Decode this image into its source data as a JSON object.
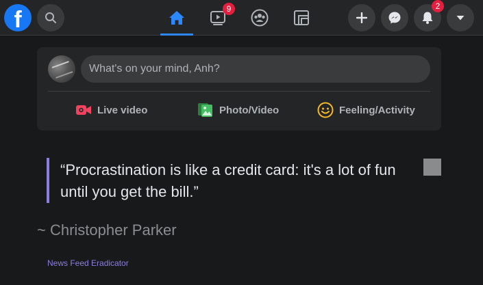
{
  "topbar": {
    "logo_letter": "f",
    "nav": [
      {
        "name": "home",
        "active": true
      },
      {
        "name": "watch",
        "badge": "9"
      },
      {
        "name": "groups"
      },
      {
        "name": "gaming"
      }
    ],
    "notifications_badge": "2"
  },
  "composer": {
    "placeholder": "What's on your mind, Anh?",
    "actions": [
      {
        "label": "Live video",
        "icon": "live-video-icon",
        "color": "#f3425f"
      },
      {
        "label": "Photo/Video",
        "icon": "photo-icon",
        "color": "#45bd62"
      },
      {
        "label": "Feeling/Activity",
        "icon": "feeling-icon",
        "color": "#f7b928"
      }
    ]
  },
  "quote": {
    "text": "“Procrastination is like a credit card: it's a lot of fun until you get the bill.”",
    "author": "~ Christopher Parker",
    "accent_color": "#8b7fe0"
  },
  "footer": {
    "link": "News Feed Eradicator"
  },
  "colors": {
    "brand": "#1877f2",
    "active_tab": "#2d88ff",
    "badge": "#e41e3f",
    "background": "#18191a",
    "surface": "#242526"
  }
}
